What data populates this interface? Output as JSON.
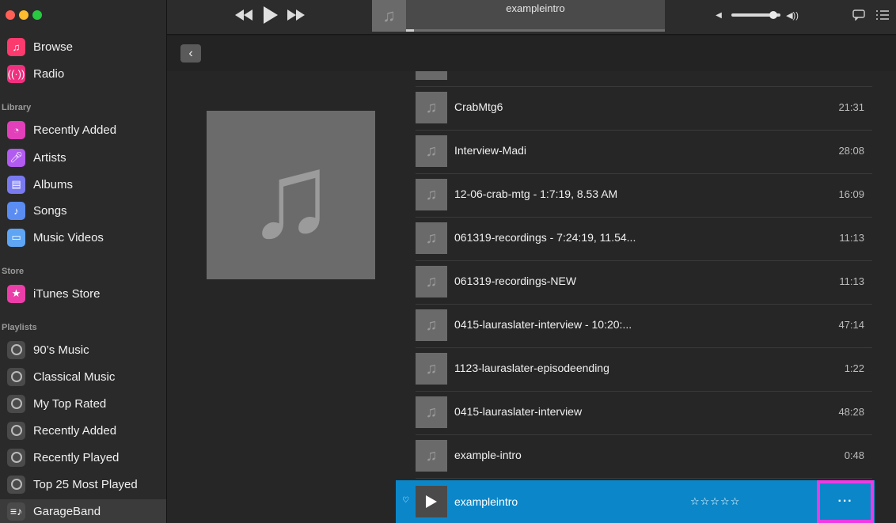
{
  "toolbar": {
    "now_playing_title": "exampleintro",
    "progress_fraction": 0.03,
    "volume_fraction": 0.85
  },
  "sidebar": {
    "top_items": [
      {
        "label": "Browse",
        "icon": "music-note-icon",
        "color": "#fb3a6e"
      },
      {
        "label": "Radio",
        "icon": "radio-waves-icon",
        "color": "#f0307f"
      }
    ],
    "library_header": "Library",
    "library_items": [
      {
        "label": "Recently Added",
        "icon": "clock-icon",
        "color": "#e23fba"
      },
      {
        "label": "Artists",
        "icon": "microphone-icon",
        "color": "#b15bf0"
      },
      {
        "label": "Albums",
        "icon": "album-stack-icon",
        "color": "#7a7af0"
      },
      {
        "label": "Songs",
        "icon": "music-note-icon",
        "color": "#5a8cf2"
      },
      {
        "label": "Music Videos",
        "icon": "tv-icon",
        "color": "#5fa5f5"
      }
    ],
    "store_header": "Store",
    "store_items": [
      {
        "label": "iTunes Store",
        "icon": "star-icon",
        "color": "#ec3ea8"
      }
    ],
    "playlists_header": "Playlists",
    "playlist_items": [
      {
        "label": "90’s Music",
        "icon": "smart-playlist-icon"
      },
      {
        "label": "Classical Music",
        "icon": "smart-playlist-icon"
      },
      {
        "label": "My Top Rated",
        "icon": "smart-playlist-icon"
      },
      {
        "label": "Recently Added",
        "icon": "smart-playlist-icon"
      },
      {
        "label": "Recently Played",
        "icon": "smart-playlist-icon"
      },
      {
        "label": "Top 25 Most Played",
        "icon": "smart-playlist-icon"
      },
      {
        "label": "GarageBand",
        "icon": "playlist-icon"
      }
    ]
  },
  "tracks": [
    {
      "name": "CrabMtg6",
      "duration": "21:31"
    },
    {
      "name": "Interview-Madi",
      "duration": "28:08"
    },
    {
      "name": "12-06-crab-mtg - 1:7:19, 8.53 AM",
      "duration": "16:09"
    },
    {
      "name": "061319-recordings - 7:24:19, 11.54...",
      "duration": "11:13"
    },
    {
      "name": "061319-recordings-NEW",
      "duration": "11:13"
    },
    {
      "name": "0415-lauraslater-interview - 10:20:...",
      "duration": "47:14"
    },
    {
      "name": "1123-lauraslater-episodeending",
      "duration": "1:22"
    },
    {
      "name": "0415-lauraslater-interview",
      "duration": "48:28"
    },
    {
      "name": "example-intro",
      "duration": "0:48"
    }
  ],
  "active_track": {
    "name": "exampleintro",
    "stars": "☆☆☆☆☆",
    "more_label": "···"
  }
}
